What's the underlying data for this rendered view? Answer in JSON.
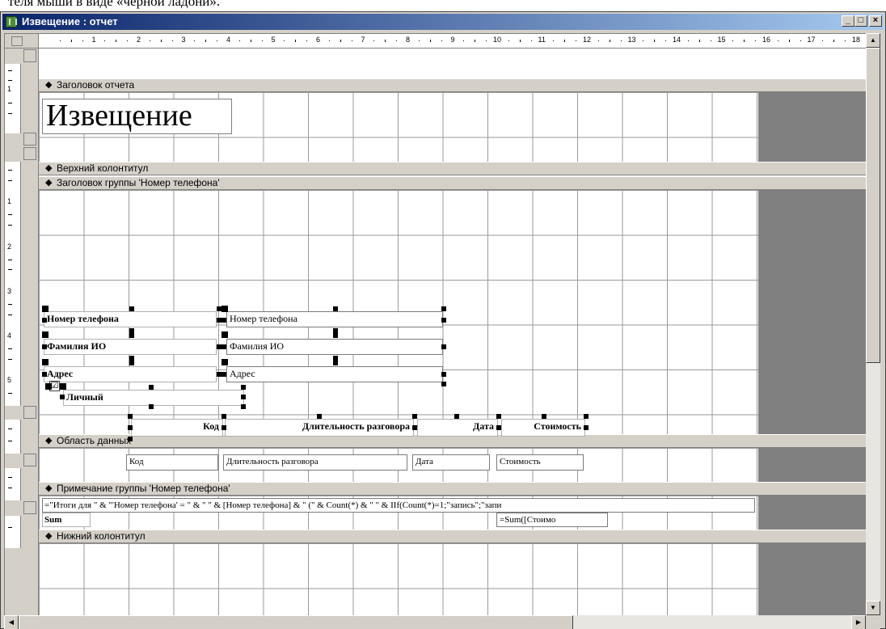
{
  "page_caption_fragment": "теля мыши в виде «черной ладони».",
  "window": {
    "title": "Извещение : отчет",
    "buttons": {
      "minimize": "_",
      "maximize": "□",
      "close": "×"
    }
  },
  "ruler": {
    "numbers": [
      "1",
      "2",
      "3",
      "4",
      "5",
      "6",
      "7",
      "8",
      "9",
      "10",
      "11",
      "12",
      "13",
      "14",
      "15",
      "16",
      "17",
      "18"
    ],
    "vertical_numbers": {
      "report_header": [
        "1"
      ],
      "group_header": [
        "1",
        "2",
        "3",
        "4",
        "5"
      ]
    }
  },
  "sections": {
    "report_header": "Заголовок отчета",
    "page_header": "Верхний колонтитул",
    "group_header": "Заголовок группы 'Номер телефона'",
    "detail": "Область данных",
    "group_footer": "Примечание группы 'Номер телефона'",
    "page_footer": "Нижний колонтитул"
  },
  "controls": {
    "report_title": "Извещение",
    "label_phone": "Номер телефона",
    "field_phone": "Номер телефона",
    "label_name": "Фамилия ИО",
    "field_name": "Фамилия ИО",
    "label_address": "Адрес",
    "field_address": "Адрес",
    "checkbox_private": "Личный",
    "checkbox_mark": "☑",
    "col_code": "Код",
    "col_duration": "Длительность разговора",
    "col_date": "Дата",
    "col_cost": "Стоимость",
    "detail_code": "Код",
    "detail_duration": "Длительность разговора",
    "detail_date": "Дата",
    "detail_cost": "Стоимость",
    "footer_expression": "=\"Итоги для \" & \"'Номер телефона' = \" & \" \" & [Номер телефона] & \" (\" & Count(*) & \" \" & IIf(Count(*)=1;\"запись\";\"запи",
    "footer_sum_label": "Sum",
    "footer_sum_expr": "=Sum([Стоимо"
  },
  "icons": {
    "section_arrow": "◆",
    "scroll_up": "▲",
    "scroll_down": "▼",
    "scroll_left": "◀",
    "scroll_right": "▶"
  },
  "colors": {
    "title_gradient_start": "#0a246a",
    "title_gradient_end": "#a6caf0",
    "window_face": "#d4d0c8",
    "outside_area": "#808080"
  }
}
